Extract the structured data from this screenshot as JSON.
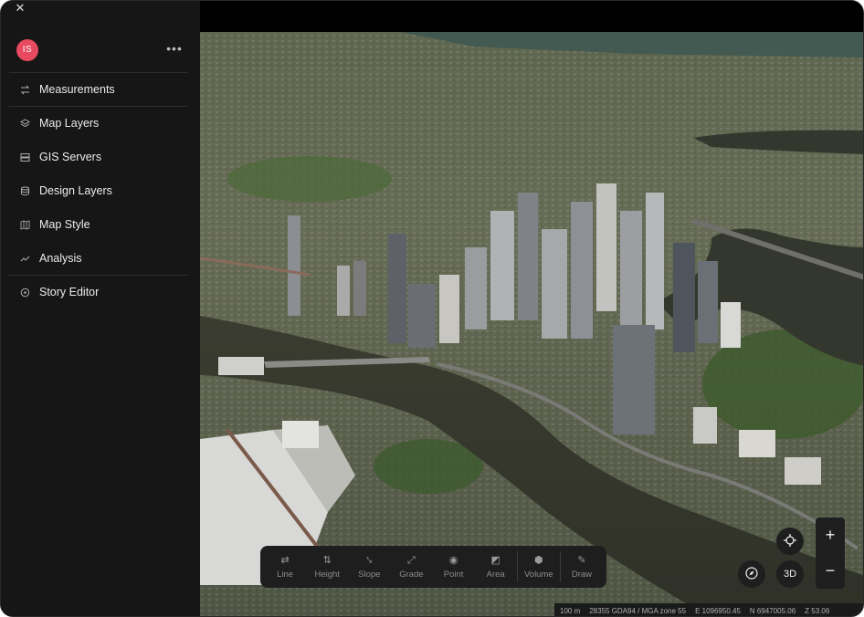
{
  "sidebar": {
    "close_icon": "close-icon",
    "avatar_initials": "IS",
    "more_label": "•••",
    "items": [
      {
        "label": "Measurements",
        "icon": "swap-arrows-icon"
      },
      {
        "label": "Map Layers",
        "icon": "layers-icon"
      },
      {
        "label": "GIS Servers",
        "icon": "server-icon"
      },
      {
        "label": "Design Layers",
        "icon": "database-icon"
      },
      {
        "label": "Map Style",
        "icon": "map-icon"
      },
      {
        "label": "Analysis",
        "icon": "trend-line-icon"
      },
      {
        "label": "Story Editor",
        "icon": "story-icon"
      }
    ]
  },
  "toolbar": {
    "tools": [
      {
        "label": "Line",
        "icon": "line-icon"
      },
      {
        "label": "Height",
        "icon": "height-icon"
      },
      {
        "label": "Slope",
        "icon": "slope-icon"
      },
      {
        "label": "Grade",
        "icon": "grade-icon"
      },
      {
        "label": "Point",
        "icon": "point-icon"
      },
      {
        "label": "Area",
        "icon": "area-icon"
      },
      {
        "label": "Volume",
        "icon": "volume-icon"
      },
      {
        "label": "Draw",
        "icon": "draw-icon"
      }
    ]
  },
  "controls": {
    "locate_icon": "crosshair-icon",
    "compass_icon": "compass-icon",
    "view_mode": "3D",
    "zoom_in": "+",
    "zoom_out": "−"
  },
  "status": {
    "scale": "100 m",
    "crs": "28355 GDA94 / MGA zone 55",
    "easting": "E 1096950.45",
    "northing": "N 6947005.06",
    "elevation": "Z 53.06"
  },
  "colors": {
    "avatar_bg": "#e84a5f",
    "sidebar_bg": "#161616",
    "toolbar_bg": "#1e1e1e"
  }
}
